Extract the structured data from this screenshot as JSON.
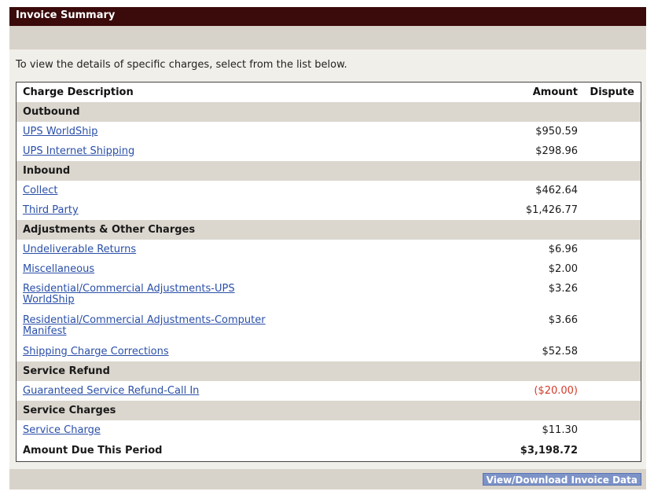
{
  "title": "Invoice Summary",
  "intro": "To view the details of specific charges, select from the list below.",
  "columns": {
    "description": "Charge Description",
    "amount": "Amount",
    "dispute": "Dispute"
  },
  "sections": [
    {
      "name": "Outbound",
      "items": [
        {
          "label": "UPS WorldShip",
          "amount": "$950.59"
        },
        {
          "label": "UPS Internet Shipping",
          "amount": "$298.96"
        }
      ]
    },
    {
      "name": "Inbound",
      "items": [
        {
          "label": "Collect",
          "amount": "$462.64"
        },
        {
          "label": "Third Party",
          "amount": "$1,426.77"
        }
      ]
    },
    {
      "name": "Adjustments & Other Charges",
      "items": [
        {
          "label": "Undeliverable Returns",
          "amount": "$6.96"
        },
        {
          "label": "Miscellaneous",
          "amount": "$2.00"
        },
        {
          "label_line1": "Residential/Commercial Adjustments-UPS",
          "label_line2": "WorldShip",
          "amount": "$3.26"
        },
        {
          "label_line1": "Residential/Commercial Adjustments-Computer",
          "label_line2": "Manifest",
          "amount": "$3.66"
        },
        {
          "label": "Shipping Charge Corrections",
          "amount": "$52.58"
        }
      ]
    },
    {
      "name": "Service Refund",
      "items": [
        {
          "label": "Guaranteed Service Refund-Call In",
          "amount": "($20.00)"
        }
      ]
    },
    {
      "name": "Service Charges",
      "items": [
        {
          "label": "Service Charge",
          "amount": "$11.30"
        }
      ]
    }
  ],
  "total": {
    "label": "Amount Due This Period",
    "amount": "$3,198.72"
  },
  "download_button": "View/Download Invoice Data",
  "colors": {
    "title_bar": "#3b0a0a",
    "link": "#2a4fa8",
    "refund": "#d43a2a",
    "category_bg": "#dbd7cf",
    "button_bg": "#7d93c8"
  }
}
